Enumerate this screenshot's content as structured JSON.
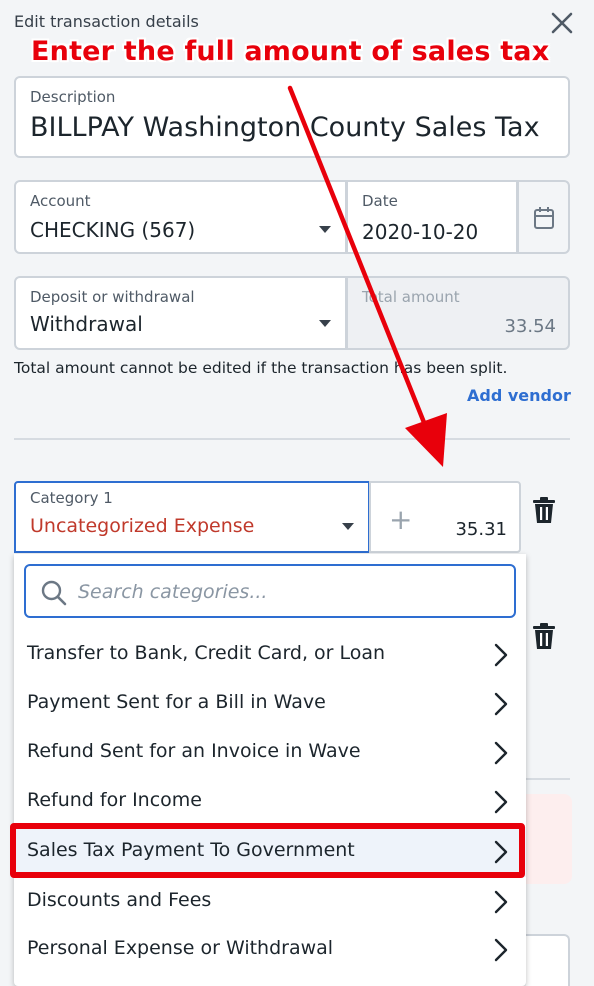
{
  "panel": {
    "title": "Edit transaction details"
  },
  "description": {
    "label": "Description",
    "value": "BILLPAY Washington County Sales Tax"
  },
  "account": {
    "label": "Account",
    "value": "CHECKING (567)"
  },
  "date": {
    "label": "Date",
    "value": "2020-10-20"
  },
  "type": {
    "label": "Deposit or withdrawal",
    "value": "Withdrawal"
  },
  "total": {
    "label": "Total amount",
    "value": "33.54"
  },
  "split_note": "Total amount cannot be edited if the transaction has been split.",
  "add_vendor": "Add vendor",
  "category": {
    "label": "Category 1",
    "value": "Uncategorized Expense",
    "amount": "35.31",
    "plus": "+"
  },
  "dropdown": {
    "search_placeholder": "Search categories...",
    "items": [
      {
        "label": "Transfer to Bank, Credit Card, or Loan"
      },
      {
        "label": "Payment Sent for a Bill in Wave"
      },
      {
        "label": "Refund Sent for an Invoice in Wave"
      },
      {
        "label": "Refund for Income"
      },
      {
        "label": "Sales Tax Payment To Government"
      },
      {
        "label": "Discounts and Fees"
      },
      {
        "label": "Personal Expense or Withdrawal"
      }
    ],
    "highlighted_item": "Sales Tax Payment To Government"
  },
  "annotation": {
    "callout": "Enter the full amount of sales tax"
  },
  "colors": {
    "accent": "#2e6ed1",
    "annotation_red": "#e8000b",
    "category_text": "#c0392b",
    "background": "#f3f5f7"
  }
}
